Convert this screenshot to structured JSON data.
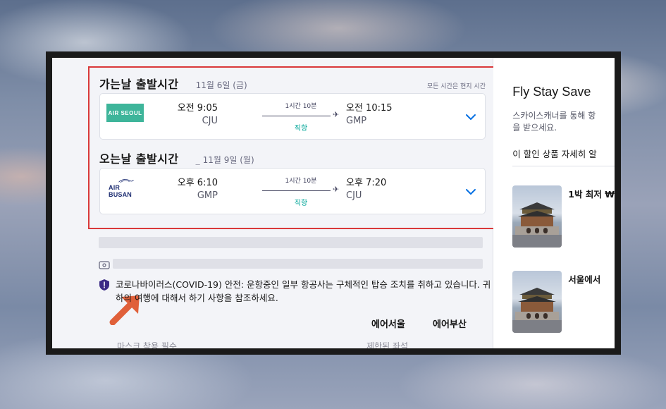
{
  "outbound": {
    "title": "가는날 출발시간",
    "date": "11월 6일 (금)",
    "timezone_note": "모든 시간은 현지 시간",
    "airline_logo_text": "AIR SEOUL",
    "departure_time": "오전 9:05",
    "departure_code": "CJU",
    "duration": "1시간 10분",
    "stops": "직항",
    "arrival_time": "오전 10:15",
    "arrival_code": "GMP"
  },
  "return": {
    "title": "오는날 출발시간",
    "date_prefix": "_",
    "date": "11월 9일 (월)",
    "airline_logo_text": "AIR BUSAN",
    "departure_time": "오후 6:10",
    "departure_code": "GMP",
    "duration": "1시간 10분",
    "stops": "직항",
    "arrival_time": "오후 7:20",
    "arrival_code": "CJU"
  },
  "covid_notice": "코로나바이러스(COVID-19) 안전: 운항중인 일부 항공사는 구체적인 탑승 조치를 취하고 있습니다. 귀하의 여행에 대해서 하기 사항을 참조하세요.",
  "airline_links": [
    "에어서울",
    "에어부산"
  ],
  "faded_row": {
    "left": "마스크 착용 필수",
    "right": "제한된 좌석"
  },
  "sidebar": {
    "title": "Fly Stay Save",
    "description_line1": "스카이스캐너를 통해 항",
    "description_line2": "을 받으세요.",
    "link": "이 할인 상품 자세히 알",
    "deals": [
      "1박 최저 ₩",
      "서울에서"
    ]
  },
  "colors": {
    "highlight_border": "#d9383a",
    "direct_label": "#00a698",
    "airseoul_brand": "#3eb59a",
    "airbusan_brand": "#1f2f73",
    "chevron": "#0770e3",
    "arrow": "#e0603a"
  },
  "icons": {
    "expand": "chevron-down-icon",
    "plane": "plane-icon",
    "ticket": "ticket-icon",
    "shield": "shield-icon",
    "pointer": "arrow-icon"
  }
}
